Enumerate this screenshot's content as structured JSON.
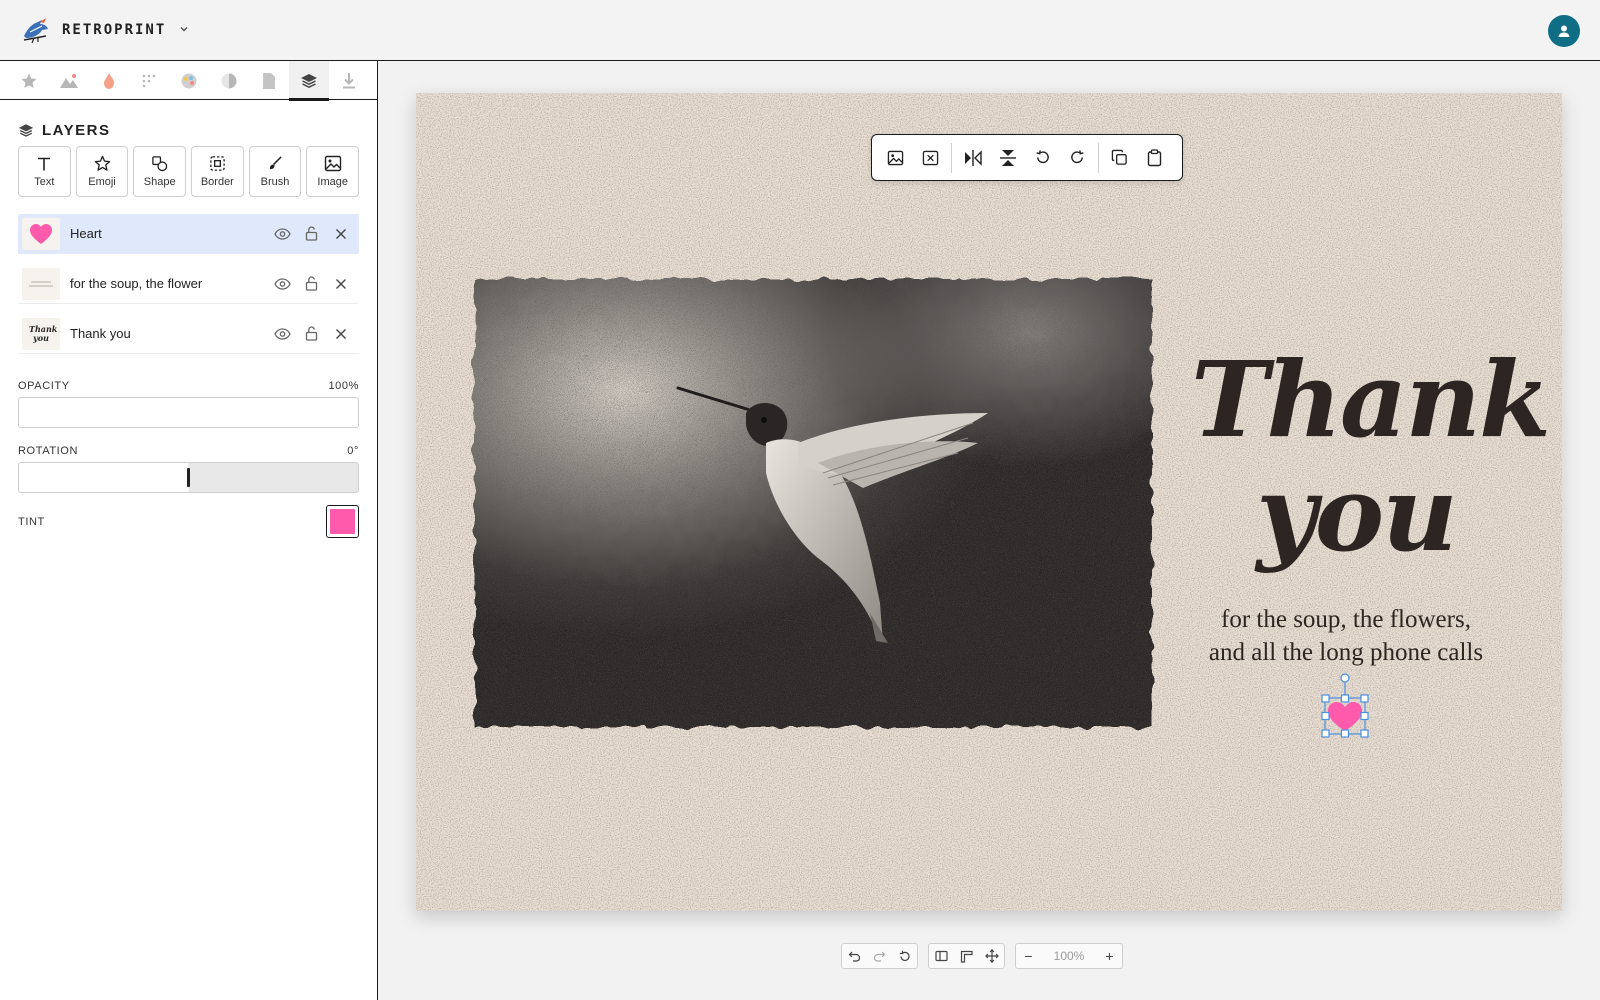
{
  "app": {
    "name": "RETROPRINT"
  },
  "header": {
    "brand_dropdown": "chevron-down",
    "avatar": "user-icon"
  },
  "tool_tabs": [
    {
      "name": "stickers",
      "icon": "star-icon"
    },
    {
      "name": "scenes",
      "icon": "mountain-icon"
    },
    {
      "name": "effects",
      "icon": "flame-icon"
    },
    {
      "name": "pattern",
      "icon": "dots-icon"
    },
    {
      "name": "colors",
      "icon": "palette-icon"
    },
    {
      "name": "tone",
      "icon": "half-circle-icon"
    },
    {
      "name": "paper",
      "icon": "paper-icon"
    },
    {
      "name": "layers",
      "icon": "layers-icon",
      "active": true
    },
    {
      "name": "export",
      "icon": "download-icon"
    }
  ],
  "panel": {
    "title": "LAYERS",
    "add_buttons": [
      {
        "label": "Text",
        "icon": "text-icon"
      },
      {
        "label": "Emoji",
        "icon": "star-outline-icon"
      },
      {
        "label": "Shape",
        "icon": "shape-icon"
      },
      {
        "label": "Border",
        "icon": "border-icon"
      },
      {
        "label": "Brush",
        "icon": "brush-icon"
      },
      {
        "label": "Image",
        "icon": "image-icon"
      }
    ],
    "layers": [
      {
        "name": "Heart",
        "selected": true
      },
      {
        "name": "for the soup, the flower",
        "selected": false
      },
      {
        "name": "Thank you",
        "selected": false
      }
    ],
    "layer_thumb_text": "Thank you",
    "opacity": {
      "label": "OPACITY",
      "value": "100%"
    },
    "rotation": {
      "label": "ROTATION",
      "value": "0°"
    },
    "tint": {
      "label": "TINT",
      "color": "#ff5aac"
    }
  },
  "card": {
    "headline_line1": "Thank",
    "headline_line2": "you",
    "subtitle_line1": "for the soup, the flowers,",
    "subtitle_line2": "and all the long phone calls",
    "background": "#e8ded3",
    "ink": "#2d2522",
    "heart_color": "#ff5aac",
    "selection_color": "#4a90e2"
  },
  "floating_toolbar": {
    "buttons": [
      "replace-image-icon",
      "remove-image-icon",
      "flip-horizontal-icon",
      "flip-vertical-icon",
      "rotate-left-icon",
      "rotate-right-icon",
      "duplicate-icon",
      "paste-icon"
    ]
  },
  "bottom_bar": {
    "zoom": "100%",
    "zoom_out": "−",
    "zoom_in": "+"
  }
}
